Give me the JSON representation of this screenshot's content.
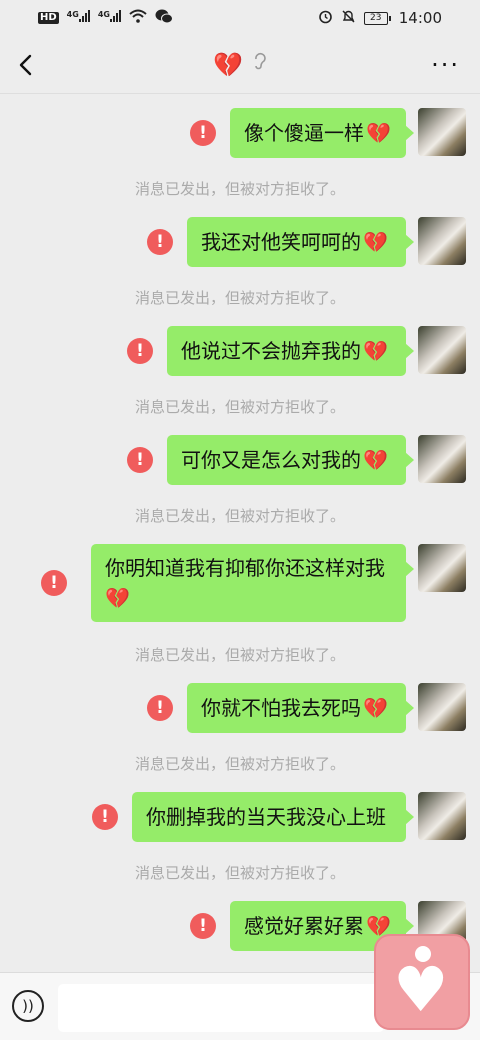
{
  "status": {
    "hd": "HD",
    "net1": "4G",
    "net2": "4G",
    "battery": "23",
    "time": "14:00"
  },
  "header": {
    "title": "💔",
    "ear_icon": "🦻"
  },
  "colors": {
    "bubble": "#95ec69",
    "error": "#f05c5c",
    "background": "#ededed",
    "broken_heart": "#d32f3f"
  },
  "messages": [
    {
      "text": "像个傻逼一样",
      "emoji": "💔"
    },
    {
      "text": "我还对他笑呵呵的",
      "emoji": "💔"
    },
    {
      "text": "他说过不会抛弃我的",
      "emoji": "💔"
    },
    {
      "text": "可你又是怎么对我的",
      "emoji": "💔"
    },
    {
      "text": "你明知道我有抑郁你还这样对我",
      "emoji": "💔"
    },
    {
      "text": "你就不怕我去死吗",
      "emoji": "💔"
    },
    {
      "text": "你删掉我的当天我没心上班",
      "emoji": ""
    },
    {
      "text": "感觉好累好累",
      "emoji": "💔"
    }
  ],
  "system_note": "消息已发出，但被对方拒收了。",
  "error_mark": "!",
  "input": {
    "placeholder": ""
  }
}
